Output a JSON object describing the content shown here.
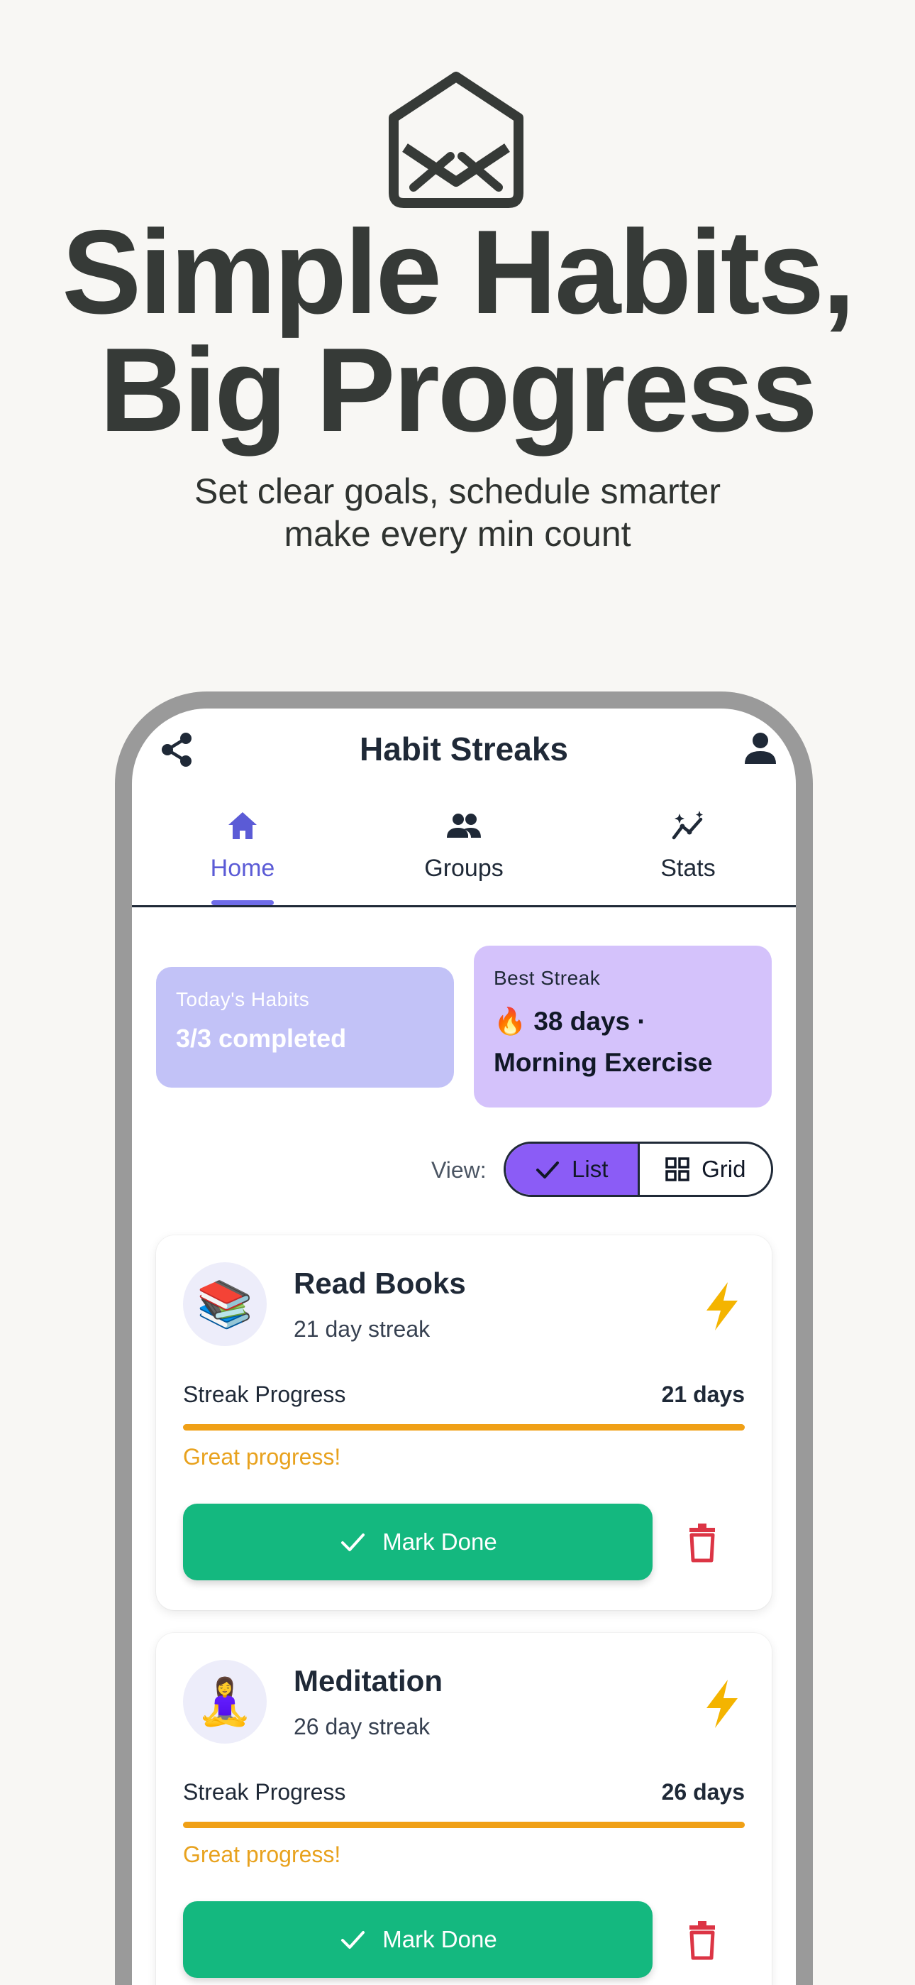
{
  "hero": {
    "title_line1": "Simple Habits,",
    "title_line2": "Big Progress",
    "subtitle_line1": "Set clear goals, schedule smarter",
    "subtitle_line2": "make every min count",
    "icon": "mail-open-icon"
  },
  "app": {
    "title": "Habit Streaks",
    "share_icon": "share-icon",
    "profile_icon": "person-icon"
  },
  "tabs": [
    {
      "label": "Home",
      "icon": "home-icon",
      "active": true
    },
    {
      "label": "Groups",
      "icon": "groups-icon",
      "active": false
    },
    {
      "label": "Stats",
      "icon": "stats-icon",
      "active": false
    }
  ],
  "summary": {
    "today_label": "Today's Habits",
    "today_value": "3/3 completed",
    "best_label": "Best Streak",
    "best_value_line1": "🔥 38 days ·",
    "best_value_line2": "Morning Exercise"
  },
  "view": {
    "label": "View:",
    "options": [
      "List",
      "Grid"
    ],
    "selected": "List"
  },
  "habits": [
    {
      "emoji": "📚",
      "name": "Read Books",
      "streak": "21 day streak",
      "progress_label": "Streak Progress",
      "progress_value": "21 days",
      "progress_fraction": 1.0,
      "note": "Great progress!",
      "action": "Mark Done"
    },
    {
      "emoji": "🧘‍♀️",
      "name": "Meditation",
      "streak": "26 day streak",
      "progress_label": "Streak Progress",
      "progress_value": "26 days",
      "progress_fraction": 1.0,
      "note": "Great progress!",
      "action": "Mark Done"
    }
  ],
  "colors": {
    "background": "#f8f7f4",
    "accent": "#5b5bd6",
    "toggle_selected": "#8b5cf6",
    "success": "#14b87f",
    "warning": "#f0a016",
    "danger": "#dc3545"
  }
}
